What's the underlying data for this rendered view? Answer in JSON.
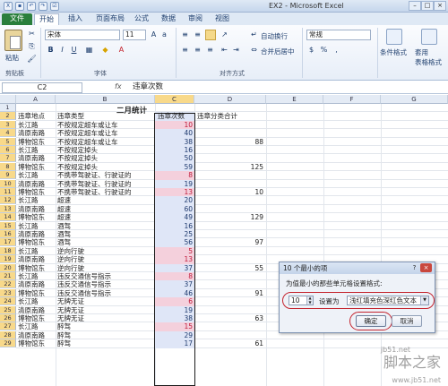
{
  "window": {
    "title": "EX2 - Microsoft Excel",
    "brand_color": "#2a7f3c",
    "accent": "#c4232d"
  },
  "quick_access": [
    "save-icon",
    "undo-icon",
    "redo-icon",
    "checkbox-icon"
  ],
  "tabs": [
    "文件",
    "开始",
    "插入",
    "页面布局",
    "公式",
    "数据",
    "审阅",
    "视图"
  ],
  "ribbon": {
    "paste_label": "粘贴",
    "clipboard_label": "剪贴板",
    "font_name": "宋体",
    "font_size": "11",
    "font_group_label": "字体",
    "align_group_label": "对齐方式",
    "wrap_text": "自动换行",
    "merge_center": "合并后居中",
    "number_format": "常规",
    "cond_format": "条件格式",
    "table_format": "套用\n表格格式",
    "bold": "B",
    "italic": "I",
    "underline": "U"
  },
  "formula_bar": {
    "name_box": "C2",
    "fx": "fx",
    "value": "违章次数"
  },
  "columns": [
    "A",
    "B",
    "C",
    "D",
    "E",
    "F",
    "G"
  ],
  "sheet": {
    "title": "二月统计",
    "headers": [
      "违章地点",
      "违章类型",
      "违章次数",
      "违章分类合计"
    ],
    "rows": [
      [
        "长江路",
        "不按规定超车或让车",
        "10",
        ""
      ],
      [
        "清原南路",
        "不按规定超车或让车",
        "40",
        ""
      ],
      [
        "博物馆东",
        "不按规定超车或让车",
        "38",
        "88"
      ],
      [
        "长江路",
        "不按规定掉头",
        "16",
        ""
      ],
      [
        "清原南路",
        "不按规定掉头",
        "50",
        ""
      ],
      [
        "博物馆东",
        "不按规定掉头",
        "59",
        "125"
      ],
      [
        "长江路",
        "不携带驾驶证、行驶证的",
        "8",
        ""
      ],
      [
        "清原南路",
        "不携带驾驶证、行驶证的",
        "19",
        ""
      ],
      [
        "博物馆东",
        "不携带驾驶证、行驶证的",
        "13",
        "10"
      ],
      [
        "长江路",
        "超速",
        "20",
        ""
      ],
      [
        "清原南路",
        "超速",
        "60",
        ""
      ],
      [
        "博物馆东",
        "超速",
        "49",
        "129"
      ],
      [
        "长江路",
        "酒驾",
        "16",
        ""
      ],
      [
        "清原南路",
        "酒驾",
        "25",
        ""
      ],
      [
        "博物馆东",
        "酒驾",
        "56",
        "97"
      ],
      [
        "长江路",
        "逆向行驶",
        "5",
        ""
      ],
      [
        "清原南路",
        "逆向行驶",
        "13",
        ""
      ],
      [
        "博物馆东",
        "逆向行驶",
        "37",
        "55"
      ],
      [
        "长江路",
        "违反交通信号指示",
        "8",
        ""
      ],
      [
        "清原南路",
        "违反交通信号指示",
        "37",
        ""
      ],
      [
        "博物馆东",
        "违反交通信号指示",
        "46",
        "91"
      ],
      [
        "长江路",
        "无牌无证",
        "6",
        ""
      ],
      [
        "清原南路",
        "无牌无证",
        "19",
        ""
      ],
      [
        "博物馆东",
        "无牌无证",
        "38",
        "63"
      ],
      [
        "长江路",
        "醉驾",
        "15",
        ""
      ],
      [
        "清原南路",
        "醉驾",
        "29",
        ""
      ],
      [
        "博物馆东",
        "醉驾",
        "17",
        "61"
      ]
    ],
    "highlight_rows": [
      0,
      6,
      8,
      15,
      16,
      18,
      21,
      24
    ]
  },
  "dialog": {
    "title": "10 个最小的项",
    "description": "为值最小的那些单元格设置格式:",
    "count": "10",
    "set_as": "设置为",
    "format": "浅红填充色深红色文本",
    "ok": "确定",
    "cancel": "取消"
  },
  "watermark": {
    "text": "脚本之家",
    "url": "jb51.net",
    "url2": "www.jb51.net"
  }
}
